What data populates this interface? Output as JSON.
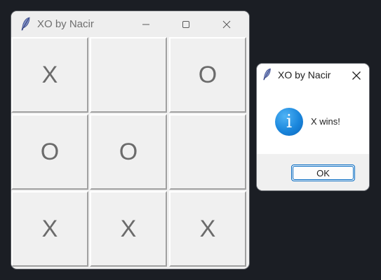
{
  "main_window": {
    "title": "XO by Nacir",
    "icon": "feather-icon",
    "controls": [
      "minimize-icon",
      "maximize-icon",
      "close-icon"
    ]
  },
  "board": {
    "cells": [
      "X",
      "",
      "O",
      "O",
      "O",
      "",
      "X",
      "X",
      "X"
    ]
  },
  "dialog": {
    "title": "XO by Nacir",
    "icon": "info-icon",
    "message": "X wins!",
    "ok_label": "OK"
  },
  "colors": {
    "background": "#1b1e24",
    "info_blue": "#1a86dc",
    "ok_border": "#0067c0"
  }
}
